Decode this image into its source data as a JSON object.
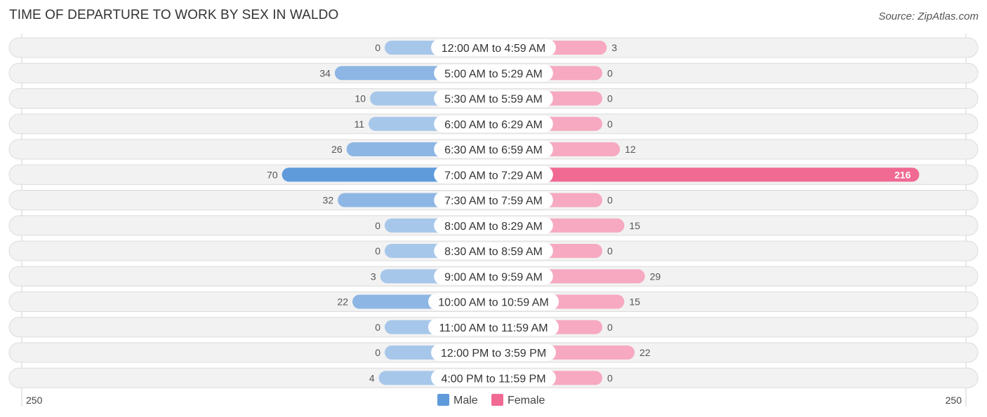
{
  "title": "TIME OF DEPARTURE TO WORK BY SEX IN WALDO",
  "source": "Source: ZipAtlas.com",
  "colors": {
    "male": "#a7c7ea",
    "male_strong": "#5f9bdb",
    "female": "#f6a9c0",
    "female_strong": "#f06a93",
    "row_bg": "#f2f2f2"
  },
  "chart_data": {
    "type": "bar",
    "orientation": "horizontal-diverging",
    "title": "TIME OF DEPARTURE TO WORK BY SEX IN WALDO",
    "categories": [
      "12:00 AM to 4:59 AM",
      "5:00 AM to 5:29 AM",
      "5:30 AM to 5:59 AM",
      "6:00 AM to 6:29 AM",
      "6:30 AM to 6:59 AM",
      "7:00 AM to 7:29 AM",
      "7:30 AM to 7:59 AM",
      "8:00 AM to 8:29 AM",
      "8:30 AM to 8:59 AM",
      "9:00 AM to 9:59 AM",
      "10:00 AM to 10:59 AM",
      "11:00 AM to 11:59 AM",
      "12:00 PM to 3:59 PM",
      "4:00 PM to 11:59 PM"
    ],
    "series": [
      {
        "name": "Male",
        "values": [
          0,
          34,
          10,
          11,
          26,
          70,
          32,
          0,
          0,
          3,
          22,
          0,
          0,
          4
        ]
      },
      {
        "name": "Female",
        "values": [
          3,
          0,
          0,
          0,
          12,
          216,
          0,
          15,
          0,
          29,
          15,
          0,
          22,
          0
        ]
      }
    ],
    "axis": {
      "left_label": "250",
      "right_label": "250",
      "range": [
        250,
        250
      ]
    },
    "legend": {
      "position": "bottom-center",
      "items": [
        "Male",
        "Female"
      ]
    }
  }
}
